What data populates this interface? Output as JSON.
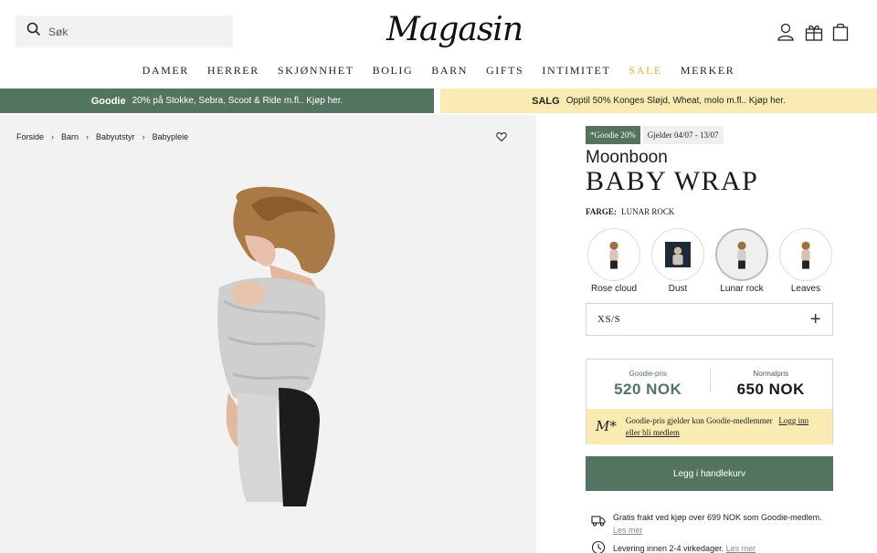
{
  "header": {
    "search": {
      "placeholder": "Søk",
      "icon": "search-icon"
    },
    "logo": "Magasin",
    "icons": [
      "user-icon",
      "gift-icon",
      "bag-icon"
    ]
  },
  "nav": {
    "items": [
      "DAMER",
      "HERRER",
      "SKJØNNHET",
      "BOLIG",
      "BARN",
      "GIFTS",
      "INTIMITET",
      "SALE",
      "MERKER"
    ]
  },
  "banners": {
    "goodie": {
      "bold": "Goodie",
      "text": "20% på Stokke, Sebra, Scoot & Ride m.fl.. Kjøp her."
    },
    "salg": {
      "bold": "SALG",
      "text": "Opptil 50% Konges Sløjd, Wheat, molo m.fl.. Kjøp her."
    }
  },
  "breadcrumb": [
    "Forside",
    "Barn",
    "Babyutstyr",
    "Babypleie"
  ],
  "product": {
    "tag_goodie": "*Goodie 20%",
    "tag_validity": "Gjelder 04/07 - 13/07",
    "brand": "Moonboon",
    "name": "BABY WRAP",
    "color_label": "FARGE:",
    "color_value": "LUNAR ROCK",
    "swatches": [
      "Rose cloud",
      "Dust",
      "Lunar rock",
      "Leaves"
    ],
    "size": "XS/S"
  },
  "price": {
    "goodie_label": "Goodie-pris",
    "goodie_amount": "520 NOK",
    "normal_label": "Normalpris",
    "normal_amount": "650 NOK",
    "note_logo": "M*",
    "note_text": "Goodie-pris gjelder kun Goodie-medlemmer",
    "note_link": "Logg inn eller bli medlem"
  },
  "cart_button": "Legg i handlekurv",
  "info": [
    {
      "text": "Gratis frakt ved kjøp over 699 NOK som Goodie-medlem.",
      "sub": "Les mer"
    },
    {
      "text": "Levering innen 2-4 virkedager.",
      "sub": "Les mer"
    }
  ],
  "colors": {
    "accent_green": "#537560",
    "sale_yellow": "#d9b33a",
    "banner_yellow": "#f9ebb1"
  }
}
